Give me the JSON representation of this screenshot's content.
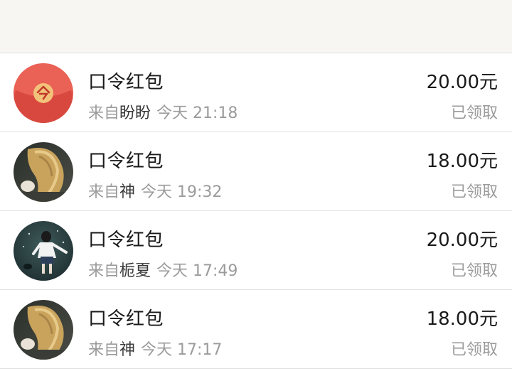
{
  "from_prefix": "来自",
  "items": [
    {
      "avatar": "red-packet-icon",
      "title": "口令红包",
      "sender": "盼盼",
      "time": "今天 21:18",
      "amount": "20.00元",
      "status": "已领取"
    },
    {
      "avatar": "user-avatar-blonde",
      "title": "口令红包",
      "sender": "神",
      "time": "今天 19:32",
      "amount": "18.00元",
      "status": "已领取"
    },
    {
      "avatar": "user-avatar-girl",
      "title": "口令红包",
      "sender": "栀夏",
      "time": "今天 17:49",
      "amount": "20.00元",
      "status": "已领取"
    },
    {
      "avatar": "user-avatar-blonde",
      "title": "口令红包",
      "sender": "神",
      "time": "今天 17:17",
      "amount": "18.00元",
      "status": "已领取"
    }
  ],
  "colors": {
    "red_packet": "#e4574d",
    "red_packet_coin": "#f3c27a",
    "muted_text": "#9b9b9b",
    "top_bar": "#f7f6f2"
  }
}
